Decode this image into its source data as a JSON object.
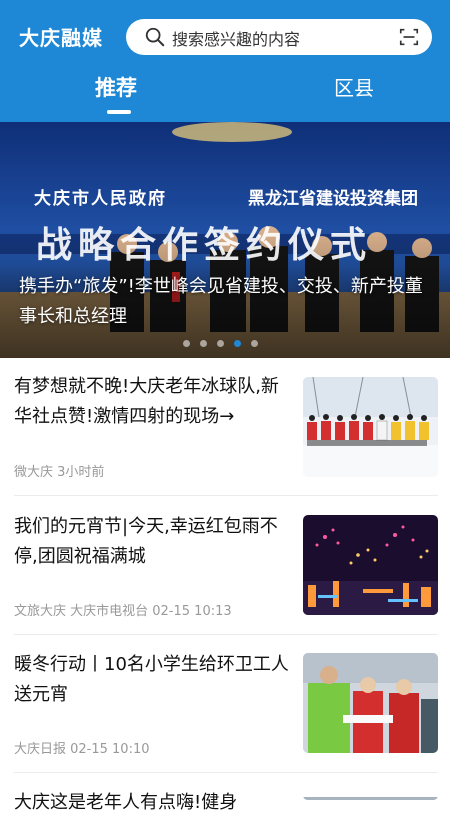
{
  "header": {
    "logo": "大庆融媒",
    "search_placeholder": "搜索感兴趣的内容",
    "tabs": [
      {
        "label": "推荐",
        "active": true
      },
      {
        "label": "区县",
        "active": false
      }
    ],
    "accent": "#1e88d6"
  },
  "banner": {
    "title": "携手办“旅发”!李世峰会见省建投、交投、新产投董事长和总经理",
    "backdrop_line1_left": "大庆市人民政府",
    "backdrop_line1_right": "黑龙江省建设投资集团",
    "backdrop_line2": "战略合作签约仪式",
    "dots_total": 5,
    "dots_active": 3
  },
  "news": [
    {
      "title": "有梦想就不晚!大庆老年冰球队,新华社点赞!激情四射的现场→",
      "meta": "微大庆   3小时前",
      "thumb": "ice-hockey-team-photo"
    },
    {
      "title": "我们的元宵节|今天,幸运红包雨不停,团圆祝福满城",
      "meta": "文旅大庆  大庆市电视台   02-15 10:13",
      "thumb": "fireworks-photo"
    },
    {
      "title": "暖冬行动丨10名小学生给环卫工人送元宵",
      "meta": "大庆日报   02-15 10:10",
      "thumb": "students-sanitation-workers-photo"
    },
    {
      "title": "大庆这是老年人有点嗨!健身",
      "meta": "",
      "thumb": "partial-photo"
    }
  ]
}
